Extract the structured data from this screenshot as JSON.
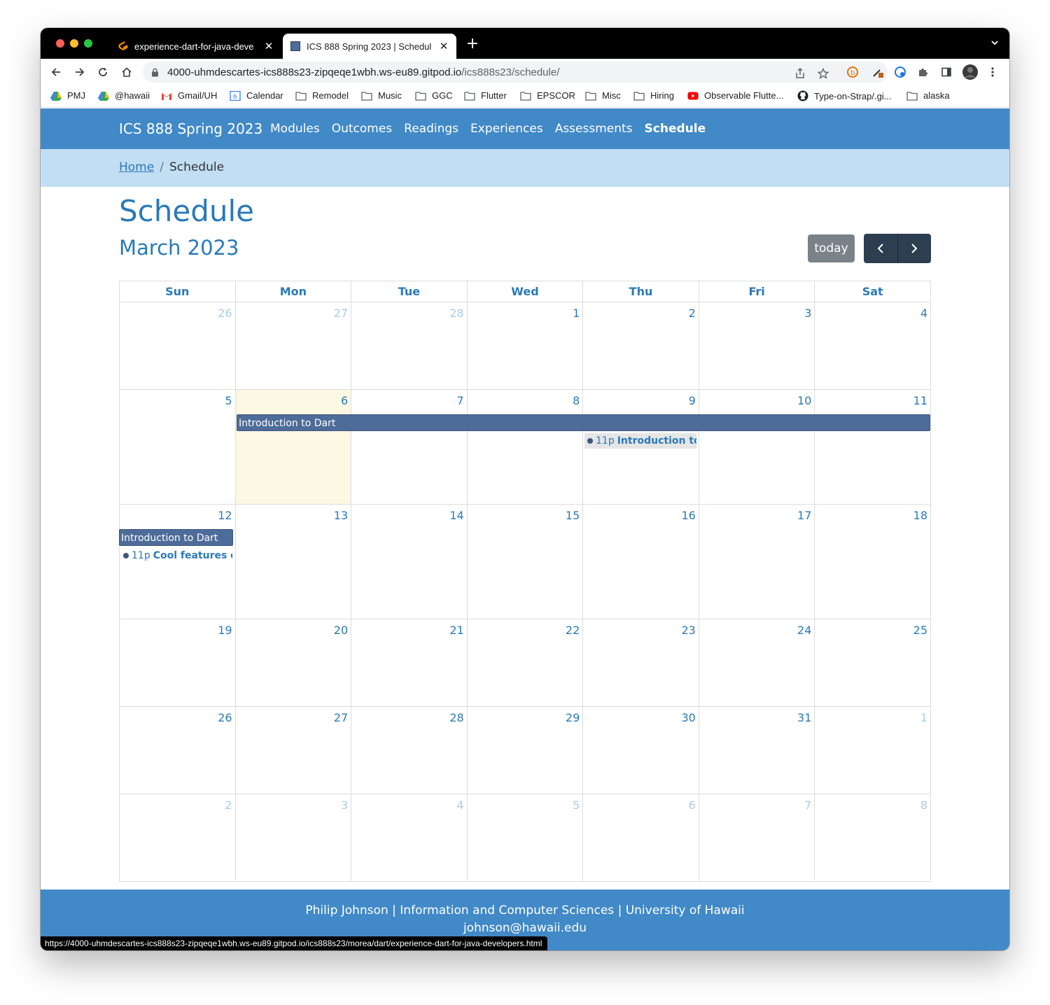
{
  "browser": {
    "tabs": [
      {
        "title": "experience-dart-for-java-deve",
        "active": false
      },
      {
        "title": "ICS 888 Spring 2023 | Schedul",
        "active": true
      }
    ],
    "url_host": "4000-uhmdescartes-ics888s23-zipqeqe1wbh.ws-eu89.gitpod.io",
    "url_path": "/ics888s23/schedule/",
    "bookmarks": [
      "PMJ",
      "@hawaii",
      "Gmail/UH",
      "Calendar",
      "Remodel",
      "Music",
      "GGC",
      "Flutter",
      "EPSCOR",
      "Misc",
      "Hiring",
      "Observable Flutte...",
      "Type-on-Strap/.gi...",
      "alaska"
    ],
    "status_url": "https://4000-uhmdescartes-ics888s23-zipqeqe1wbh.ws-eu89.gitpod.io/ics888s23/morea/dart/experience-dart-for-java-developers.html"
  },
  "navbar": {
    "brand": "ICS 888 Spring 2023",
    "links": [
      "Modules",
      "Outcomes",
      "Readings",
      "Experiences",
      "Assessments",
      "Schedule"
    ],
    "active": "Schedule"
  },
  "breadcrumb": {
    "home": "Home",
    "sep": "/",
    "current": "Schedule"
  },
  "page": {
    "title": "Schedule",
    "month": "March 2023"
  },
  "controls": {
    "today": "today"
  },
  "calendar": {
    "weekdays": [
      "Sun",
      "Mon",
      "Tue",
      "Wed",
      "Thu",
      "Fri",
      "Sat"
    ],
    "weeks": [
      [
        "26",
        "27",
        "28",
        "1",
        "2",
        "3",
        "4"
      ],
      [
        "5",
        "6",
        "7",
        "8",
        "9",
        "10",
        "11"
      ],
      [
        "12",
        "13",
        "14",
        "15",
        "16",
        "17",
        "18"
      ],
      [
        "19",
        "20",
        "21",
        "22",
        "23",
        "24",
        "25"
      ],
      [
        "26",
        "27",
        "28",
        "29",
        "30",
        "31",
        "1"
      ],
      [
        "2",
        "3",
        "4",
        "5",
        "6",
        "7",
        "8"
      ]
    ],
    "events": {
      "module_bar": "Introduction to Dart",
      "thu_event_time": "11p",
      "thu_event_name": "Introduction to Dart",
      "sun_event_time": "11p",
      "sun_event_name": "Cool features of Dart"
    }
  },
  "footer": {
    "line1": "Philip Johnson | Information and Computer Sciences | University of Hawaii",
    "line2": "johnson@hawaii.edu"
  },
  "colors": {
    "navbar": "#4189c7",
    "crumbbar": "#c2def3",
    "accent": "#2a7ab8",
    "event": "#4e6c99",
    "today_cell": "#fcf8e3"
  }
}
